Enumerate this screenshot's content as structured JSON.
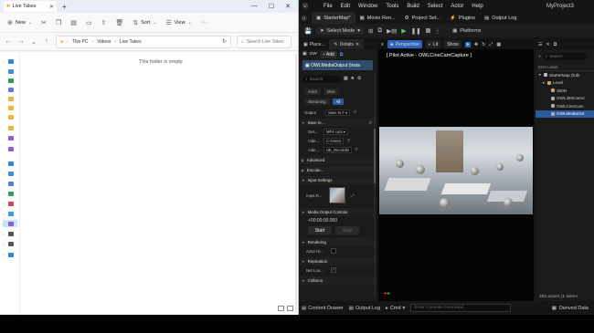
{
  "explorer": {
    "tab_title": "Live Takes",
    "new_label": "New",
    "sort_label": "Sort",
    "view_label": "View",
    "breadcrumb": [
      "This PC",
      "Videos",
      "Live Takes"
    ],
    "search_placeholder": "Search Live Takes",
    "empty_message": "This folder is empty."
  },
  "ue": {
    "menu": [
      "File",
      "Edit",
      "Window",
      "Tools",
      "Build",
      "Select",
      "Actor",
      "Help"
    ],
    "project_name": "MyProject3",
    "tabs": [
      "StarterMap*",
      "Movie Ren...",
      "Project Set...",
      "Plugins",
      "Output Log"
    ],
    "select_mode": "Select Mode",
    "platforms_label": "Platforms",
    "details": {
      "tab_place": "Place...",
      "tab_details": "Details",
      "add_label": "Add",
      "actor_name": "OWLMediaOutput (Insta",
      "search_placeholder": "Search",
      "chips_row1": [
        "Actor",
        "Misc"
      ],
      "chips_row2": [
        "Streaming",
        "All"
      ],
      "output_label": "Output",
      "output_value": "Save to F",
      "save_section": "Save to...",
      "props": [
        {
          "label": "Des...",
          "value": "MP4 cont"
        },
        {
          "label": "Vide...",
          "value": "C:/Users"
        },
        {
          "label": "Vide...",
          "value": "UE_Recordin"
        }
      ],
      "advanced": "Advanced",
      "encode": "Encode...",
      "input_settings": "Input Settings",
      "input_label": "Input R...",
      "media_output_controls": "Media Output Controls",
      "timecode": "+00:00:00.000",
      "start_label": "Start",
      "stop_label": "Stop",
      "rendering": "Rendering",
      "actor_hidden": "Actor Hi...",
      "replication": "Replication",
      "net_load": "Net Loa...",
      "collision": "Collision"
    },
    "viewport": {
      "perspective": "Perspective",
      "lit": "Lit",
      "show": "Show",
      "pilot_text": "[ Pilot Active - OWLCineCamCapture ]"
    },
    "outliner": {
      "search_placeholder": "Search",
      "header": "Item Label",
      "items": [
        {
          "label": "StarterMap (Edit",
          "indent": 0,
          "selected": false,
          "color": "#bbbbbb"
        },
        {
          "label": "Level",
          "indent": 1,
          "selected": false,
          "color": "#c9a85a"
        },
        {
          "label": "360N",
          "indent": 2,
          "selected": false,
          "color": "#c9a85a"
        },
        {
          "label": "OWL360CamC",
          "indent": 2,
          "selected": false,
          "color": "#aaaaaa"
        },
        {
          "label": "OWLCineCam",
          "indent": 2,
          "selected": false,
          "color": "#aaaaaa"
        },
        {
          "label": "OWLMediaOut",
          "indent": 2,
          "selected": true,
          "color": "#aaaaaa"
        }
      ],
      "footer": "253 actors (1 select"
    },
    "bottombar": {
      "content_drawer": "Content Drawer",
      "output_log": "Output Log",
      "cmd": "Cmd",
      "cmd_placeholder": "Enter Console Command",
      "derived_data": "Derived Data"
    }
  }
}
